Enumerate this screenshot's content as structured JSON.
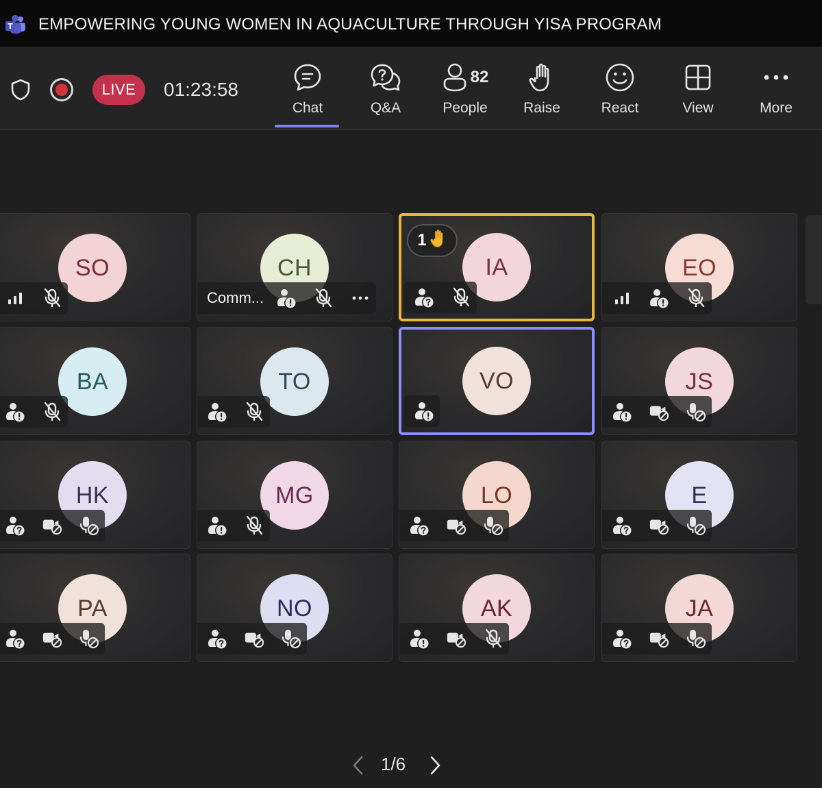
{
  "window": {
    "title": "EMPOWERING YOUNG WOMEN IN AQUACULTURE THROUGH YISA PROGRAM",
    "app_icon": "teams-icon"
  },
  "status": {
    "live_label": "LIVE",
    "elapsed": "01:23:58"
  },
  "toolbar": {
    "chat": "Chat",
    "qa": "Q&A",
    "people": "People",
    "people_count": "82",
    "raise": "Raise",
    "react": "React",
    "view": "View",
    "more": "More",
    "active": "Chat"
  },
  "colors": {
    "accent": "#7f85f5",
    "live": "#c4314b",
    "raised_border": "#e8b53f",
    "speaker_border": "#8b8ff7"
  },
  "tiles": [
    {
      "initials": "SO",
      "bg": "#f2d4d6",
      "fg": "#7a2d35",
      "icons": [
        "signal-icon",
        "mic-off-icon"
      ]
    },
    {
      "initials": "CH",
      "bg": "#e7edd5",
      "fg": "#4a5a2a",
      "name": "Comm...",
      "icons": [
        "alert-person-icon",
        "mic-off-icon",
        "more-icon"
      ]
    },
    {
      "initials": "IA",
      "bg": "#f2d6dc",
      "fg": "#7a2d45",
      "hand_count": "1",
      "icons": [
        "help-person-icon",
        "mic-off-icon"
      ]
    },
    {
      "initials": "EO",
      "bg": "#f7dcd6",
      "fg": "#8a3a2a",
      "icons": [
        "signal-icon",
        "alert-person-icon",
        "mic-off-icon"
      ]
    },
    {
      "initials": "BA",
      "bg": "#d6eef2",
      "fg": "#2a5a62",
      "icons": [
        "alert-person-icon",
        "mic-off-icon"
      ]
    },
    {
      "initials": "TO",
      "bg": "#dde8ee",
      "fg": "#2f4a5a",
      "icons": [
        "alert-person-icon",
        "mic-off-icon"
      ]
    },
    {
      "initials": "VO",
      "bg": "#f0e2da",
      "fg": "#5a3a2a",
      "icons": [
        "alert-person-icon"
      ]
    },
    {
      "initials": "JS",
      "bg": "#f2d8de",
      "fg": "#7a2d45",
      "icons": [
        "alert-person-icon",
        "camera-blocked-icon",
        "mic-blocked-icon"
      ]
    },
    {
      "initials": "HK",
      "bg": "#e2def0",
      "fg": "#3a2f5a",
      "icons": [
        "help-person-icon",
        "camera-blocked-icon",
        "mic-blocked-icon"
      ]
    },
    {
      "initials": "MG",
      "bg": "#f0d8e6",
      "fg": "#6a2a52",
      "icons": [
        "alert-person-icon",
        "mic-off-icon"
      ]
    },
    {
      "initials": "LO",
      "bg": "#f4d8ce",
      "fg": "#7a3320",
      "icons": [
        "help-person-icon",
        "camera-blocked-icon",
        "mic-blocked-icon"
      ]
    },
    {
      "initials": "E",
      "bg": "#e2e2f2",
      "fg": "#2f2f5a",
      "icons": [
        "help-person-icon",
        "camera-blocked-icon",
        "mic-blocked-icon"
      ]
    },
    {
      "initials": "PA",
      "bg": "#f0e2da",
      "fg": "#5a3a2a",
      "icons": [
        "help-person-icon",
        "camera-blocked-icon",
        "mic-blocked-icon"
      ]
    },
    {
      "initials": "NO",
      "bg": "#dedef2",
      "fg": "#2a2a62",
      "icons": [
        "help-person-icon",
        "camera-blocked-icon",
        "mic-blocked-icon"
      ]
    },
    {
      "initials": "AK",
      "bg": "#f2d8de",
      "fg": "#6a2035",
      "icons": [
        "alert-person-icon",
        "camera-blocked-icon",
        "mic-off-icon"
      ]
    },
    {
      "initials": "JA",
      "bg": "#f4d8d8",
      "fg": "#6a2a2a",
      "icons": [
        "help-person-icon",
        "camera-blocked-icon",
        "mic-blocked-icon"
      ]
    }
  ],
  "pager": {
    "label": "1/6"
  }
}
